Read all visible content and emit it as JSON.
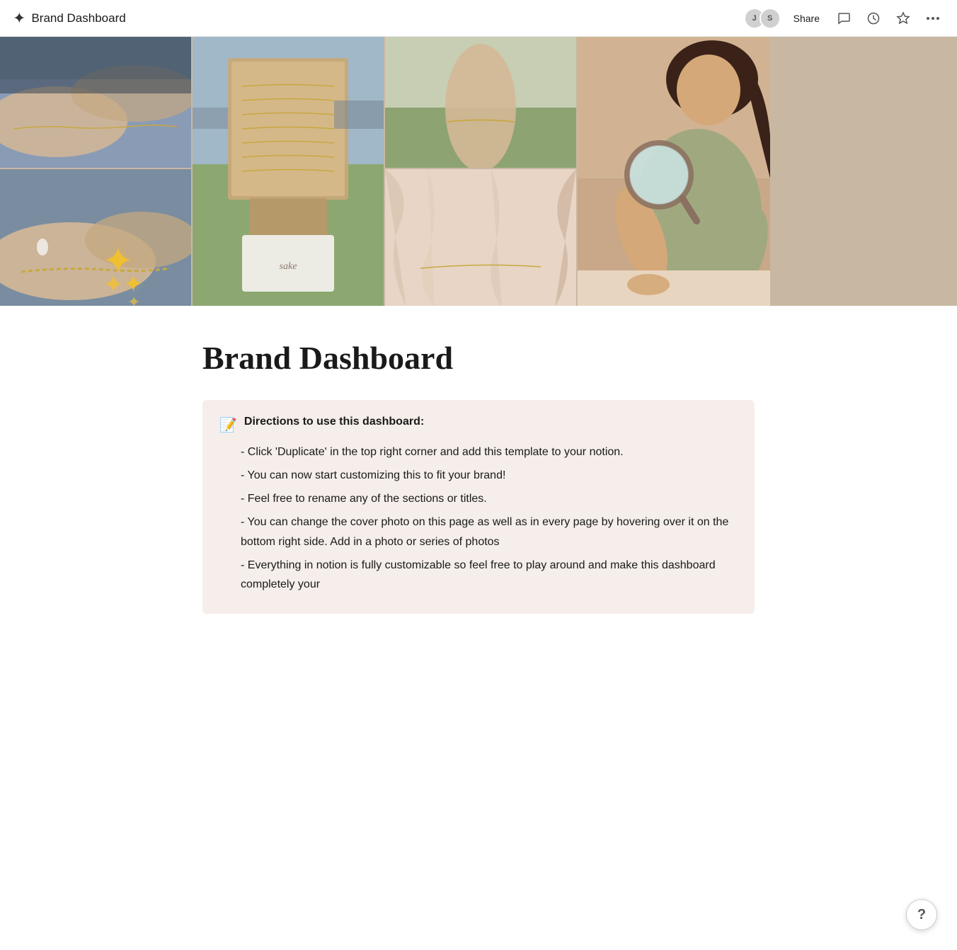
{
  "topbar": {
    "icon": "✦",
    "title": "Brand Dashboard",
    "avatar1_initials": "J",
    "avatar2_initials": "S",
    "share_label": "Share",
    "comment_icon": "💬",
    "history_icon": "🕐",
    "star_icon": "☆",
    "more_icon": "···"
  },
  "cover": {
    "sparkle": "✦✦"
  },
  "main": {
    "page_title": "Brand Dashboard",
    "callout": {
      "emoji": "📝",
      "title": "Directions to use this dashboard:",
      "lines": [
        "- Click 'Duplicate' in the top right corner and add this template to your notion.",
        "- You can now start customizing this to fit your brand!",
        "- Feel free to rename any of the sections or titles.",
        "- You can change the cover photo on this page as well as in every page by hovering over it on the bottom right side. Add in a photo or series of photos",
        "- Everything in notion is fully customizable so feel free to play around and make this dashboard completely your"
      ]
    }
  },
  "help": {
    "label": "?"
  }
}
